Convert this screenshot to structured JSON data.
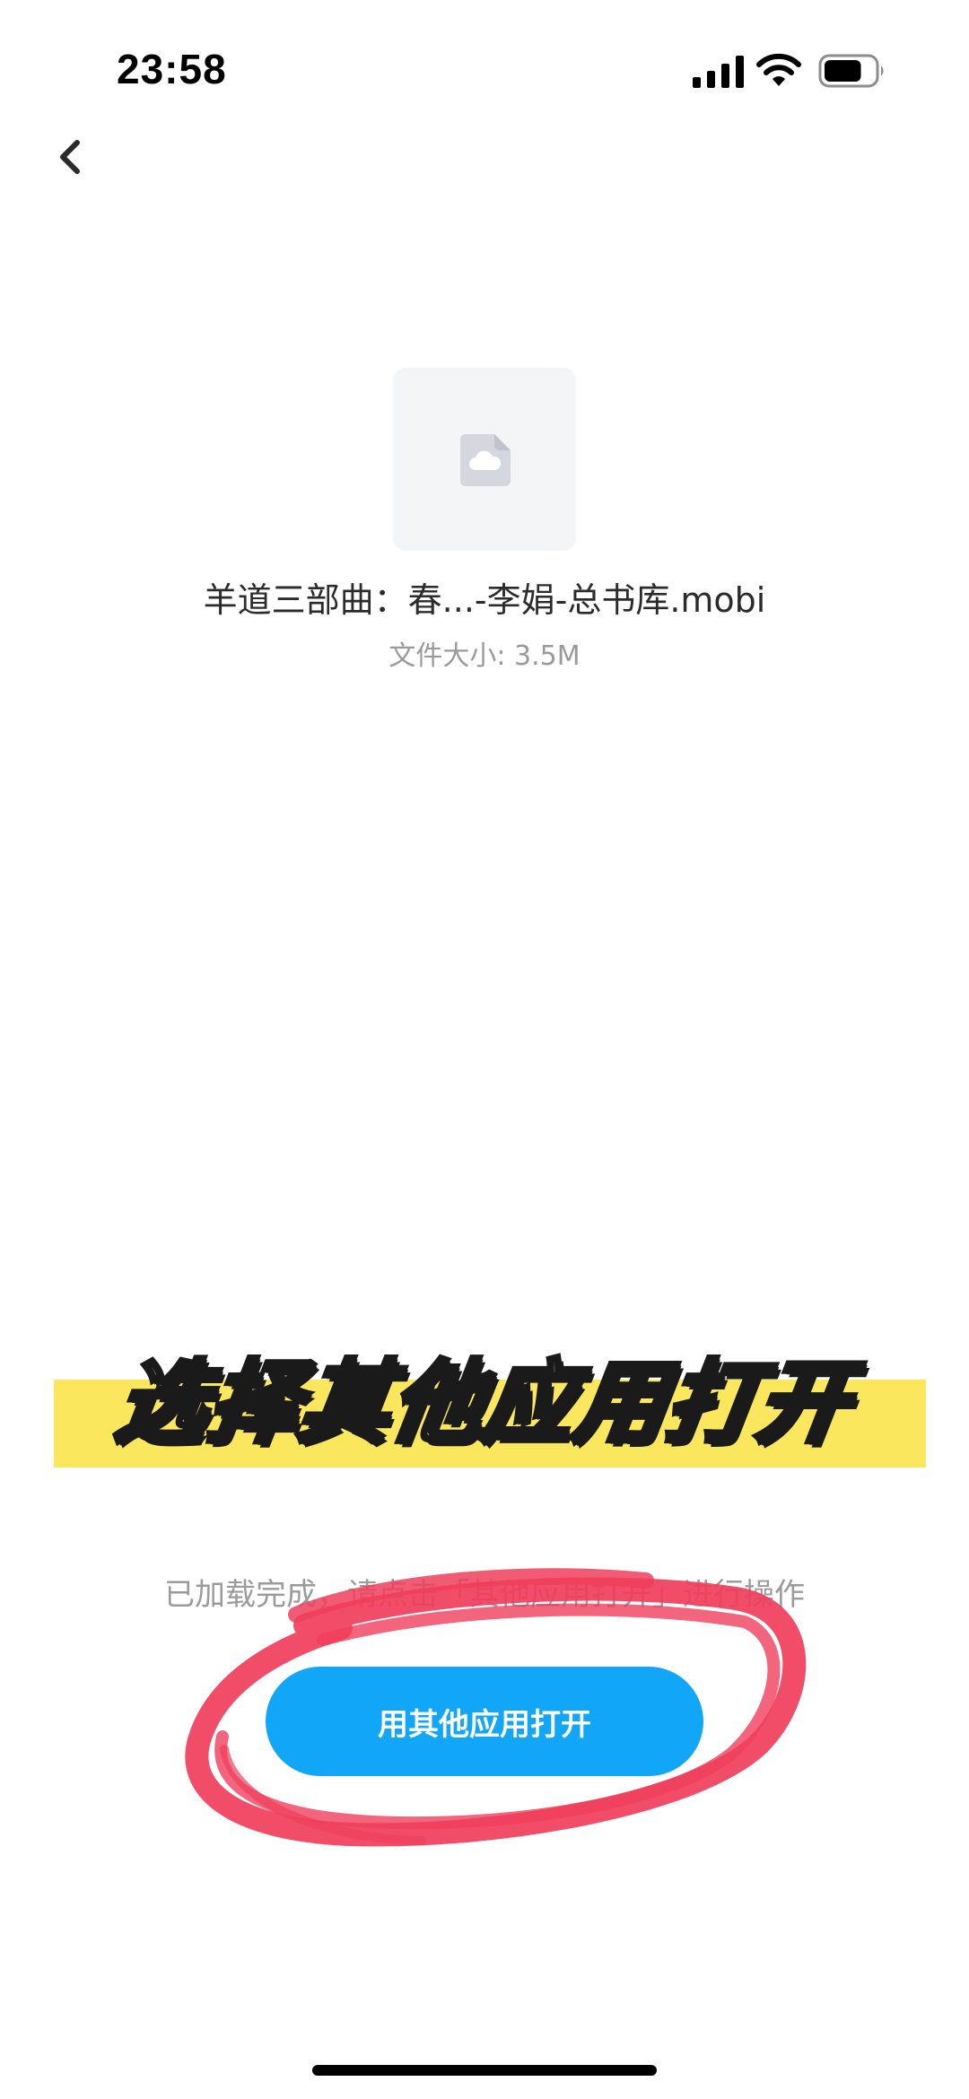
{
  "status_bar": {
    "time": "23:58",
    "signal_icon": "cellular-signal-icon",
    "wifi_icon": "wifi-icon",
    "battery_icon": "battery-icon",
    "battery_level": 0.75
  },
  "nav": {
    "back_icon": "chevron-left-icon"
  },
  "file": {
    "icon": "cloud-document-icon",
    "name": "羊道三部曲：春...-李娟-总书库.mobi",
    "size_label": "文件大小: 3.5M"
  },
  "overlay": {
    "banner_text": "选择其他应用打开",
    "banner_color": "#fbe75d",
    "annotation_color": "#f03e5c"
  },
  "action": {
    "hint": "已加载完成，请点击「其他应用打开」进行操作",
    "button_label": "用其他应用打开",
    "button_color": "#12a6f9"
  }
}
